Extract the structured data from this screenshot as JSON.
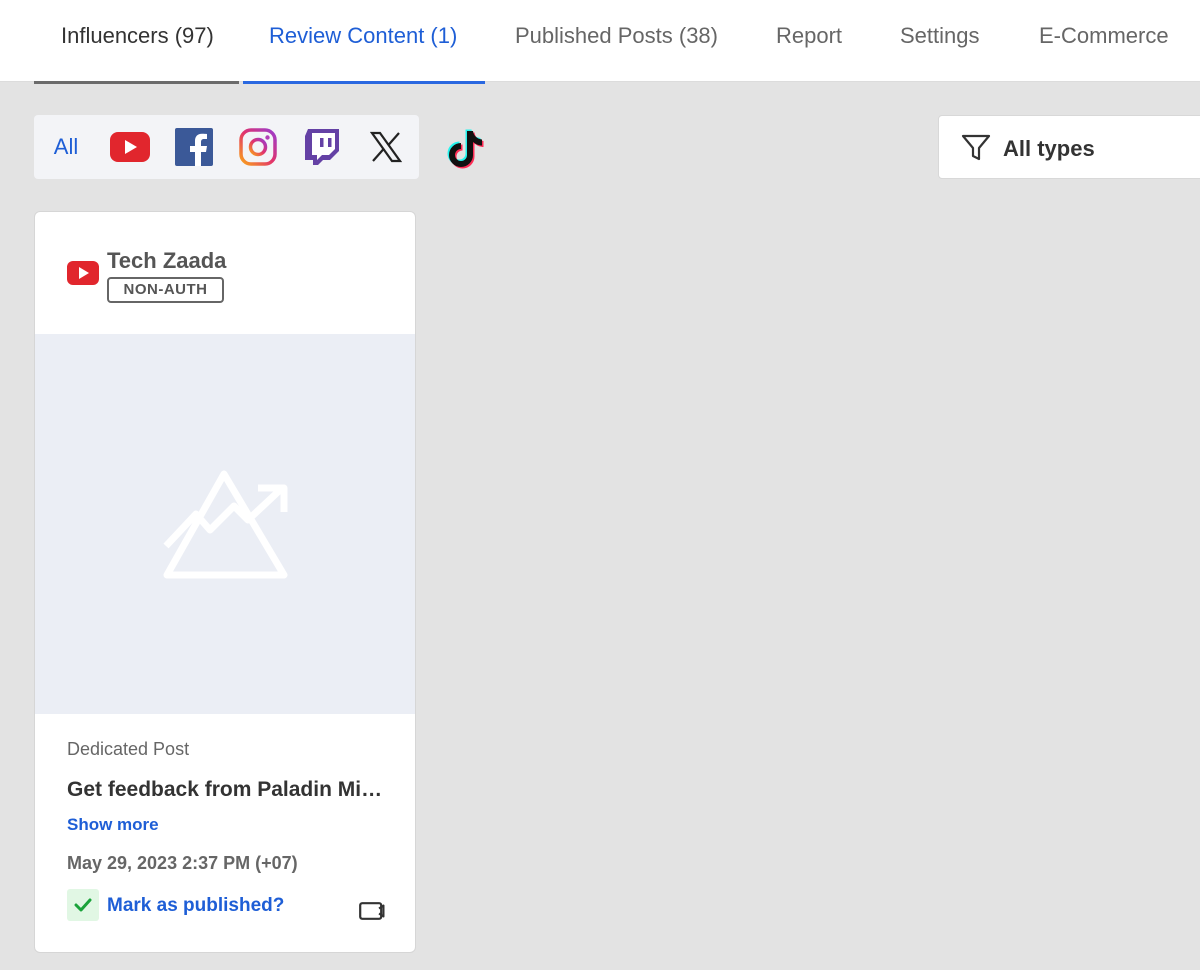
{
  "tabs": [
    {
      "label": "Influencers (97)"
    },
    {
      "label": "Review Content (1)"
    },
    {
      "label": "Published Posts (38)"
    },
    {
      "label": "Report"
    },
    {
      "label": "Settings"
    },
    {
      "label": "E-Commerce"
    }
  ],
  "active_tab": "Review Content (1)",
  "platform_filter": {
    "all_label": "All",
    "platforms": [
      "youtube-icon",
      "facebook-icon",
      "instagram-icon",
      "twitch-icon",
      "x-icon",
      "tiktok-icon"
    ]
  },
  "type_filter": {
    "label": "All types"
  },
  "colors": {
    "accent": "#1e5ed6",
    "youtube": "#e1262d",
    "facebook": "#3b5998",
    "twitch": "#6441a5",
    "success": "#1aa33a"
  },
  "card": {
    "influencer_name": "Tech Zaada",
    "auth_badge": "NON-AUTH",
    "post_type": "Dedicated Post",
    "title": "Get feedback from Paladin Mining and get paid!",
    "show_more": "Show more",
    "date": "May 29, 2023 2:37 PM (+07)",
    "mark_published": "Mark as published?"
  }
}
